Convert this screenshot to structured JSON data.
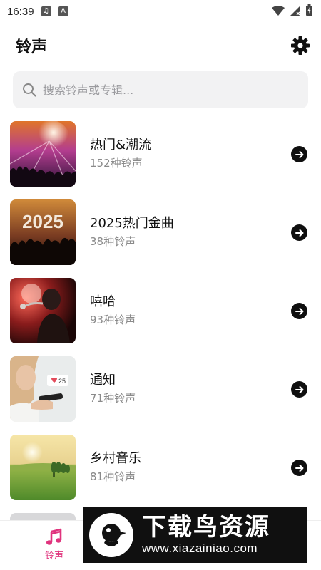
{
  "status_bar": {
    "time": "16:39"
  },
  "header": {
    "title": "铃声"
  },
  "search": {
    "placeholder": "搜索铃声或专辑..."
  },
  "categories": [
    {
      "title": "热门&潮流",
      "count": "152种铃声",
      "thumb": "concert-crowd"
    },
    {
      "title": "2025热门金曲",
      "count": "38种铃声",
      "thumb": "2025-party",
      "thumb_text": "2025"
    },
    {
      "title": "嘻哈",
      "count": "93种铃声",
      "thumb": "hip-hop-singer"
    },
    {
      "title": "通知",
      "count": "71种铃声",
      "thumb": "phone-notification",
      "thumb_text": "25"
    },
    {
      "title": "乡村音乐",
      "count": "81种铃声",
      "thumb": "countryside-field"
    }
  ],
  "bottom_nav": {
    "tabs": [
      {
        "label": "铃声",
        "icon": "music-note-icon",
        "active": true
      }
    ]
  },
  "watermark": {
    "title": "下载鸟资源",
    "url": "www.xiazainiao.com"
  },
  "colors": {
    "accent": "#e0337d",
    "search_bg": "#f2f2f3",
    "muted_text": "#8a8a8a"
  }
}
